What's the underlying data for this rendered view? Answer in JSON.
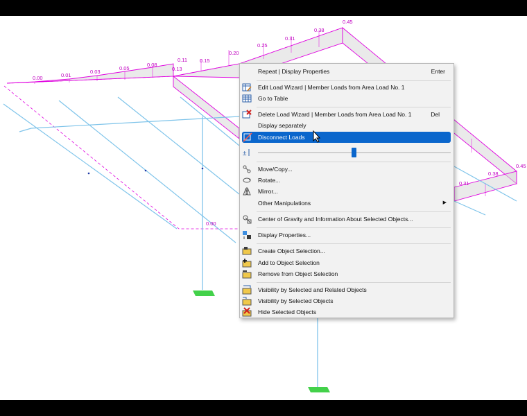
{
  "load_labels": {
    "back_left": [
      "0.00",
      "0.01",
      "0.03",
      "0.05",
      "0.08",
      "0.11",
      "0.13"
    ],
    "back_right": [
      "0.15",
      "0.20",
      "0.25",
      "0.31",
      "0.38",
      "0.45"
    ],
    "front": [
      "0.00",
      "0.31",
      "0.38",
      "0.45"
    ]
  },
  "colors": {
    "member": "#7fc4ea",
    "load": "#e000e0",
    "load_fill": "#d8d8d8",
    "support": "#43d14a",
    "highlight": "#0a66cc"
  },
  "menu": {
    "repeat": {
      "label": "Repeat | Display Properties",
      "shortcut": "Enter"
    },
    "edit_wizard": {
      "label": "Edit Load Wizard | Member Loads from Area Load No. 1",
      "icon": "edit-wizard-icon"
    },
    "go_to_table": {
      "label": "Go to Table",
      "icon": "table-icon"
    },
    "delete_wizard": {
      "label": "Delete Load Wizard | Member Loads from Area Load No. 1",
      "shortcut": "Del",
      "icon": "delete-wizard-icon"
    },
    "display_separately": {
      "label": "Display separately"
    },
    "disconnect": {
      "label": "Disconnect Loads",
      "icon": "disconnect-icon"
    },
    "slider": {
      "icon": "load-scale-icon",
      "value": 0.5
    },
    "move_copy": {
      "label": "Move/Copy...",
      "icon": "move-copy-icon"
    },
    "rotate": {
      "label": "Rotate...",
      "icon": "rotate-icon"
    },
    "mirror": {
      "label": "Mirror...",
      "icon": "mirror-icon"
    },
    "other": {
      "label": "Other Manipulations"
    },
    "center_gravity": {
      "label": "Center of Gravity and Information About Selected Objects...",
      "icon": "center-gravity-icon"
    },
    "display_props": {
      "label": "Display Properties...",
      "icon": "display-properties-icon"
    },
    "create_selection": {
      "label": "Create Object Selection...",
      "icon": "create-selection-icon"
    },
    "add_selection": {
      "label": "Add to Object Selection",
      "icon": "add-selection-icon"
    },
    "remove_selection": {
      "label": "Remove from Object Selection",
      "icon": "remove-selection-icon"
    },
    "vis_related": {
      "label": "Visibility by Selected and Related Objects",
      "icon": "visibility-related-icon"
    },
    "vis_selected": {
      "label": "Visibility by Selected Objects",
      "icon": "visibility-selected-icon"
    },
    "hide_selected": {
      "label": "Hide Selected Objects",
      "icon": "hide-icon"
    }
  }
}
